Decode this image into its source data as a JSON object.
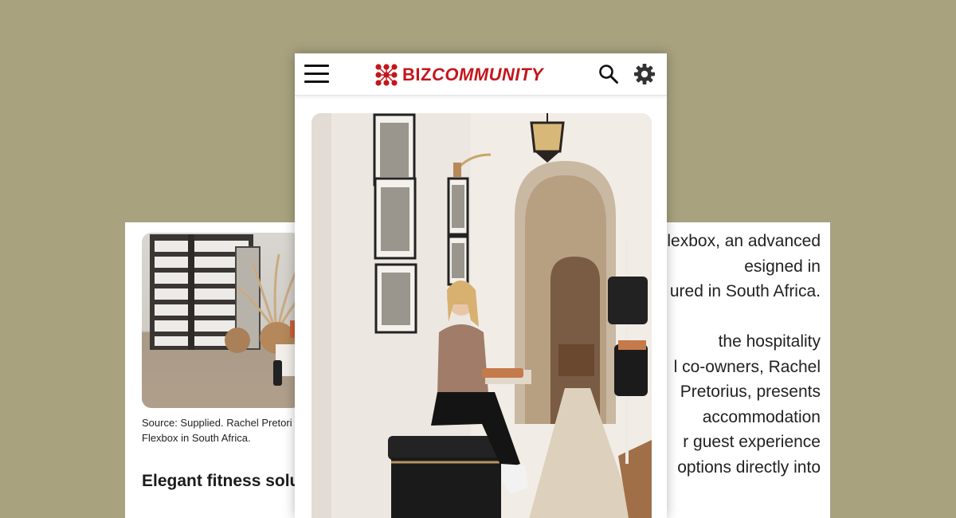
{
  "background_color": "#a8a27f",
  "brand": {
    "name_part1": "BIZ",
    "name_part2": "COMMUNITY",
    "color": "#c4161c"
  },
  "header": {
    "icons": [
      "hamburger-menu-icon",
      "search-icon",
      "gear-icon"
    ]
  },
  "left_panel": {
    "caption_line1": "Source: Supplied. Rachel Pretori",
    "caption_line2": "Flexbox in South Africa.",
    "heading": "Elegant fitness solu"
  },
  "right_panel": {
    "lines": [
      "lexbox, an advanced",
      "esigned in",
      "ured in South Africa.",
      "",
      "the hospitality",
      "l co-owners, Rachel",
      "Pretorius, presents",
      "accommodation",
      "r guest experience",
      "options directly into"
    ]
  }
}
